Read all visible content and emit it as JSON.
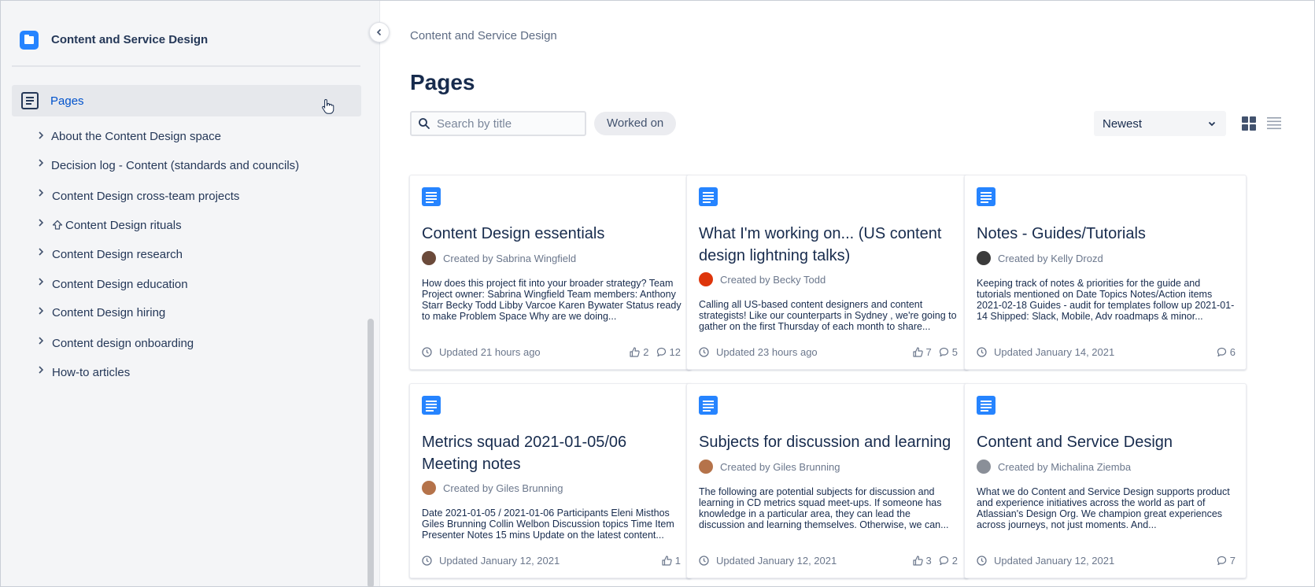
{
  "space": {
    "title": "Content and Service Design"
  },
  "nav": {
    "pages_label": "Pages",
    "items": [
      {
        "label": "About the Content Design space"
      },
      {
        "label": "Decision log - Content (standards and councils)"
      },
      {
        "label": "Content Design cross-team projects"
      },
      {
        "label": "Content Design rituals"
      },
      {
        "label": "Content Design research"
      },
      {
        "label": "Content Design education"
      },
      {
        "label": "Content Design hiring"
      },
      {
        "label": "Content design onboarding"
      },
      {
        "label": "How-to articles"
      }
    ]
  },
  "main": {
    "breadcrumb": "Content and Service Design",
    "title": "Pages",
    "search_placeholder": "Search by title",
    "filter_label": "Worked on",
    "sort_label": "Newest"
  },
  "cards": [
    {
      "title": "Content Design essentials",
      "author": "Created by Sabrina Wingfield",
      "excerpt": "How does this project fit into your broader strategy? Team Project owner: Sabrina Wingfield   Team members: Anthony Starr  Becky Todd  Libby Varcoe  Karen Bywater Status ready to make Problem Space Why are we doing...",
      "updated": "Updated 21 hours ago",
      "likes": "2",
      "comments": "12",
      "avatar_color": "#6b4a3a"
    },
    {
      "title": "What I'm working on... (US content design lightning talks)",
      "author": "Created by Becky Todd",
      "excerpt": "Calling all US-based content designers and content strategists! Like our counterparts in Sydney , we're going to gather on the first Thursday of each month to share...",
      "updated": "Updated 23 hours ago",
      "likes": "7",
      "comments": "5",
      "avatar_color": "#de350b"
    },
    {
      "title": "Notes - Guides/Tutorials",
      "author": "Created by Kelly Drozd",
      "excerpt": "Keeping track of notes & priorities for the guide and tutorials mentioned on Date Topics Notes/Action items 2021-02-18 Guides - audit for templates follow up 2021-01-14 Shipped: Slack, Mobile, Adv roadmaps & minor...",
      "updated": "Updated January 14, 2021",
      "likes": "",
      "comments": "6",
      "avatar_color": "#3b3b3b"
    },
    {
      "title": "Metrics squad 2021-01-05/06 Meeting notes",
      "author": "Created by Giles Brunning",
      "excerpt": "Date 2021-01-05 / 2021-01-06 Participants Eleni Misthos  Giles Brunning  Collin Welbon Discussion topics Time Item Presenter Notes 15 mins Update on the latest content...",
      "updated": "Updated January 12, 2021",
      "likes": "1",
      "comments": "",
      "avatar_color": "#b5734a"
    },
    {
      "title": "Subjects for discussion and learning",
      "author": "Created by Giles Brunning",
      "excerpt": "The following are potential subjects for discussion and learning in CD metrics squad meet-ups. If someone has knowledge in a particular area, they can lead the discussion and learning themselves. Otherwise, we can...",
      "updated": "Updated January 12, 2021",
      "likes": "3",
      "comments": "2",
      "avatar_color": "#b5734a"
    },
    {
      "title": "Content and Service Design",
      "author": "Created by Michalina Ziemba",
      "excerpt": "What we do Content and Service Design supports product and experience initiatives across the world as part of Atlassian's Design Org. We champion great experiences across journeys, not just moments. And...",
      "updated": "Updated January 12, 2021",
      "likes": "",
      "comments": "7",
      "avatar_color": "#8a8f98"
    }
  ],
  "colors": {
    "accent": "#0052cc",
    "doc_icon": "#2684ff"
  }
}
